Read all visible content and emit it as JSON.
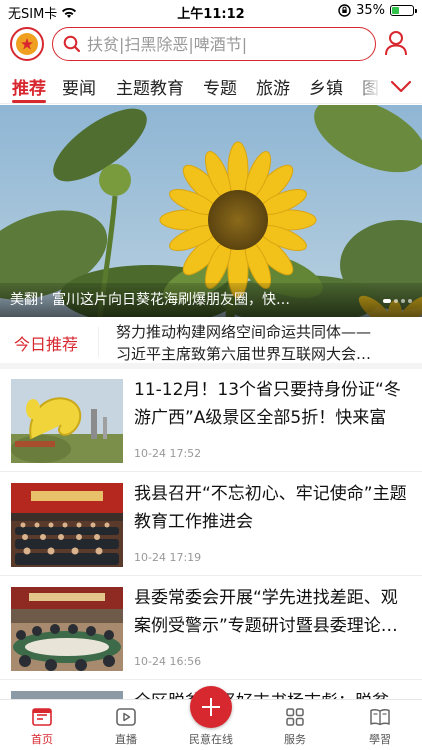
{
  "status_bar": {
    "carrier": "无SIM卡",
    "time": "上午11:12",
    "battery": "35%",
    "battery_level": 0.35
  },
  "header": {
    "search_placeholder": "扶贫|扫黑除恶|啤酒节|"
  },
  "tabs": [
    {
      "label": "推荐",
      "active": true
    },
    {
      "label": "要闻"
    },
    {
      "label": "主题教育"
    },
    {
      "label": "专题"
    },
    {
      "label": "旅游"
    },
    {
      "label": "乡镇"
    },
    {
      "label": "图"
    }
  ],
  "banner": {
    "title": "美翻！富川这片向日葵花海刷爆朋友圈，快…"
  },
  "today": {
    "label": "今日推荐",
    "line1": "努力推动构建网络空间命运共同体——",
    "line2": "习近平主席致第六届世界互联网大会…"
  },
  "news": [
    {
      "title": "11-12月！13个省只要持身份证“冬游广西”A级景区全部5折！快来富川…",
      "time": "10-24 17:52"
    },
    {
      "title": "我县召开“不忘初心、牢记使命”主题教育工作推进会",
      "time": "10-24 17:19"
    },
    {
      "title": "县委常委会开展“学先进找差距、观案例受警示”专题研讨暨县委理论…",
      "time": "10-24 16:56"
    },
    {
      "title": "全区脱贫攻坚好支书杨志彪：脱贫",
      "time": ""
    }
  ],
  "bottom_nav": [
    {
      "label": "首页",
      "icon": "home-icon",
      "active": true
    },
    {
      "label": "直播",
      "icon": "live-icon"
    },
    {
      "label": "民意在线",
      "icon": "plus-icon"
    },
    {
      "label": "服务",
      "icon": "grid-icon"
    },
    {
      "label": "學習",
      "icon": "book-icon"
    }
  ],
  "colors": {
    "accent": "#d8282f",
    "battery_green": "#30c24a"
  }
}
